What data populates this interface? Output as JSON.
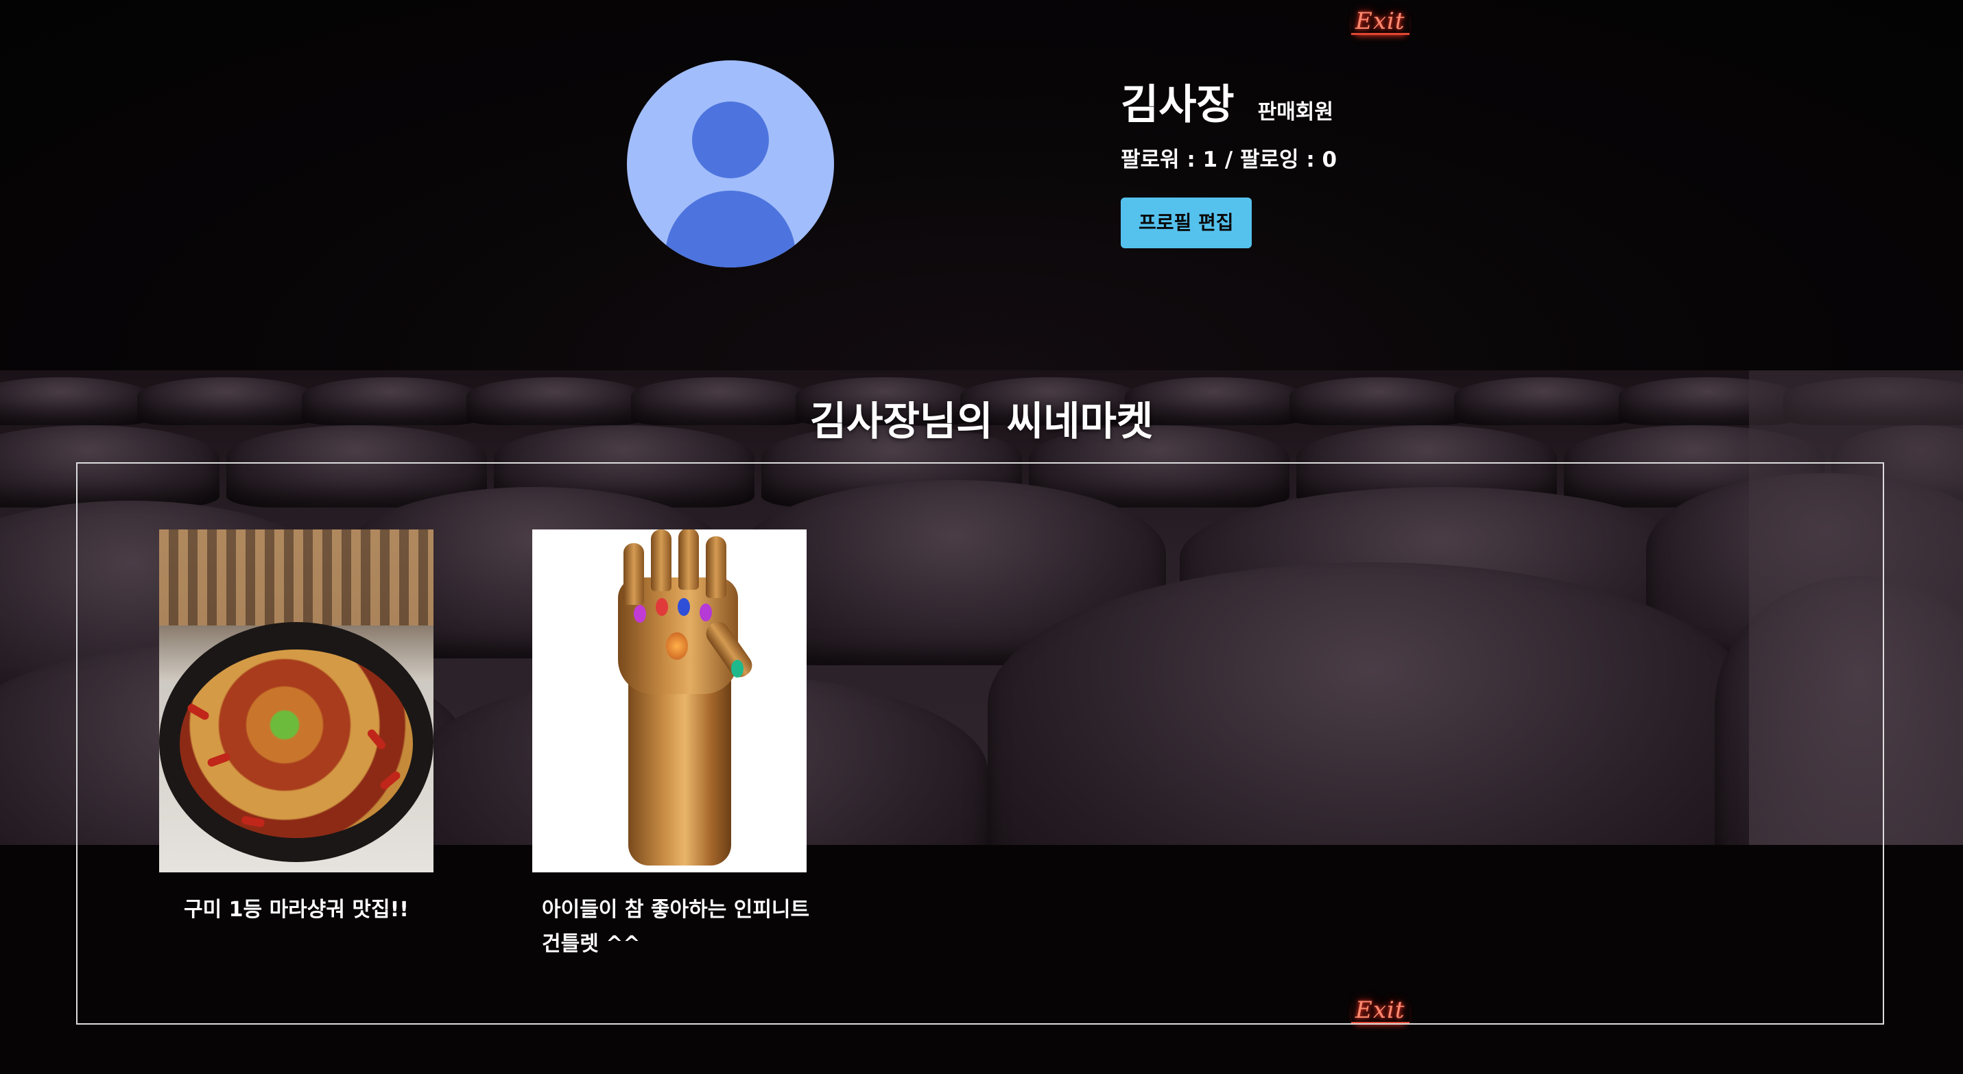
{
  "exit_sign_top": "Exit",
  "exit_sign_bottom": "Exit",
  "profile": {
    "name": "김사장",
    "member_type": "판매회원",
    "follow_text": "팔로워 : 1 / 팔로잉 : 0",
    "edit_button": "프로필 편집"
  },
  "market": {
    "title": "김사장님의 씨네마켓",
    "products": [
      {
        "title": "구미 1등 마라샹궈 맛집!!",
        "image": "mala-xiangguo-photo"
      },
      {
        "title": "아이들이 참 좋아하는 인피니트 건틀렛 ^^",
        "image": "infinity-gauntlet-photo"
      }
    ]
  },
  "colors": {
    "accent_button": "#55c2ee",
    "avatar_bg": "#a1bdfb",
    "avatar_fg": "#4d74de",
    "background": "#050304"
  }
}
